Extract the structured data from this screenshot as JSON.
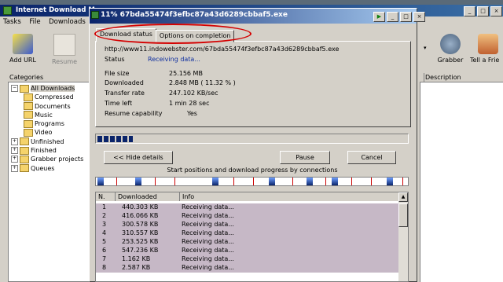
{
  "main_window": {
    "title": "Internet Download M",
    "menu": [
      "Tasks",
      "File",
      "Downloads"
    ],
    "toolbar_left": [
      {
        "label": "Add URL",
        "icon": "add-url-icon"
      },
      {
        "label": "Resume",
        "icon": "resume-icon"
      }
    ],
    "toolbar_right": [
      {
        "label": "Grabber",
        "icon": "grabber-icon"
      },
      {
        "label": "Tell a Frie",
        "icon": "tell-a-friend-icon"
      }
    ],
    "categories_header": "Categories",
    "tree": {
      "all_downloads": "All Downloads",
      "children": [
        "Compressed",
        "Documents",
        "Music",
        "Programs",
        "Video"
      ],
      "others": [
        "Unfinished",
        "Finished",
        "Grabber projects",
        "Queues"
      ]
    },
    "list_header": "Description"
  },
  "dialog": {
    "title": "11% 67bda55474f3efbc87a43d6289cbbaf5.exe",
    "tabs": [
      "Download status",
      "Options on completion"
    ],
    "url": "http://www11.indowebster.com/67bda55474f3efbc87a43d6289cbbaf5.exe",
    "status_label": "Status",
    "status_value": "Receiving data...",
    "fields": [
      {
        "label": "File size",
        "value": "25.156  MB"
      },
      {
        "label": "Downloaded",
        "value": "2.848  MB  ( 11.32 % )"
      },
      {
        "label": "Transfer rate",
        "value": "247.102  KB/sec"
      },
      {
        "label": "Time left",
        "value": "1 min 28 sec"
      },
      {
        "label": "Resume capability",
        "value": "Yes"
      }
    ],
    "progress": 0.1132,
    "buttons": {
      "hide_details": "<< Hide details",
      "pause": "Pause",
      "cancel": "Cancel"
    },
    "connections_label": "Start positions and download progress by connections",
    "table": {
      "headers": [
        "N.",
        "Downloaded",
        "Info"
      ],
      "rows": [
        [
          "1",
          "440.303  KB",
          "Receiving data..."
        ],
        [
          "2",
          "416.066  KB",
          "Receiving data..."
        ],
        [
          "3",
          "300.578  KB",
          "Receiving data..."
        ],
        [
          "4",
          "310.557  KB",
          "Receiving data..."
        ],
        [
          "5",
          "253.525  KB",
          "Receiving data..."
        ],
        [
          "6",
          "547.236  KB",
          "Receiving data..."
        ],
        [
          "7",
          "1.162  KB",
          "Receiving data..."
        ],
        [
          "8",
          "2.587  KB",
          "Receiving data..."
        ]
      ]
    }
  },
  "colors": {
    "titlebar": "#0a246a",
    "highlight_oval": "#d40000",
    "row_bg": "#c6b8c6"
  }
}
